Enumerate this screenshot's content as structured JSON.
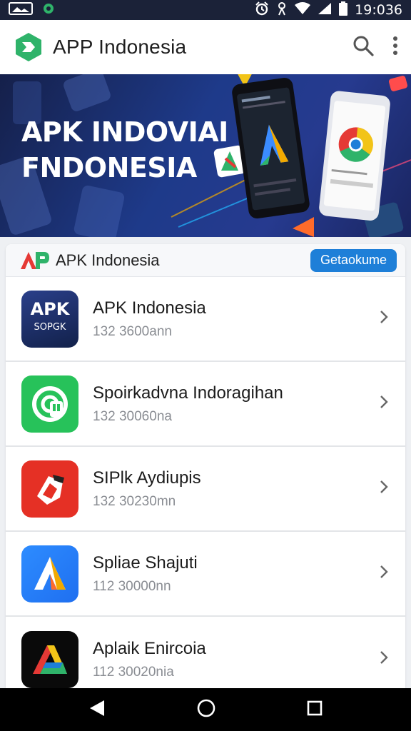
{
  "status_bar": {
    "time": "19:036"
  },
  "app_bar": {
    "title": "APP Indonesia"
  },
  "banner": {
    "line1": "APK INDOVIAI",
    "line2": "FNDONESIA"
  },
  "section": {
    "title": "APK Indonesia",
    "button_label": "Getaokume"
  },
  "apps": [
    {
      "name": "APK Indonesia",
      "meta": "132 3600ann",
      "icon_top": "APK",
      "icon_bottom": "SOPGK"
    },
    {
      "name": "Spoirkadvna Indoragihan",
      "meta": "132 30060na"
    },
    {
      "name": "SIPlk Aydiupis",
      "meta": "132 30230mn"
    },
    {
      "name": "Spliae Shajuti",
      "meta": "112 30000nn"
    },
    {
      "name": "Aplaik Enircoia",
      "meta": "112 30020nia"
    }
  ],
  "colors": {
    "accent": "#1e7fd8",
    "brand_green": "#2fb36a",
    "status_bar": "#1b2238",
    "banner_start": "#15204a"
  },
  "icons": [
    "gallery-icon",
    "alarm-icon",
    "wifi-icon",
    "signal-icon",
    "battery-icon",
    "search-icon",
    "more-vert-icon",
    "chevron-right-icon",
    "back-icon",
    "home-icon",
    "recents-icon"
  ]
}
